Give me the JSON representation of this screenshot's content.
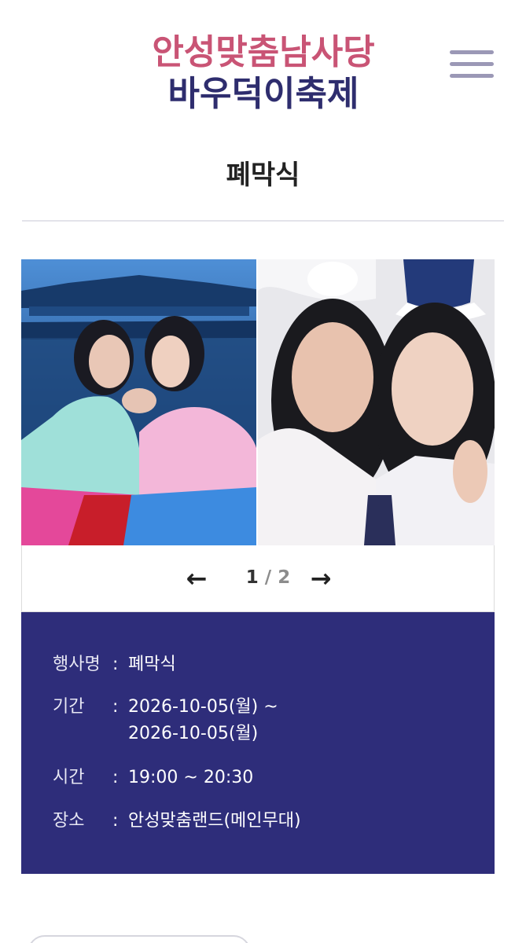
{
  "header": {
    "logo_line1": "안성맞춤남사당",
    "logo_line2": "바우덕이축제",
    "menu_icon": "hamburger-menu-icon"
  },
  "page": {
    "title": "폐막식"
  },
  "gallery": {
    "images": [
      {
        "description_icon": "performers-photo"
      },
      {
        "description_icon": "performers-photo"
      }
    ],
    "current": "1",
    "separator": "/",
    "total": "2",
    "prev_icon": "arrow-left-icon",
    "next_icon": "arrow-right-icon",
    "prev_glyph": "←",
    "next_glyph": "→"
  },
  "event_info": {
    "colon": ":",
    "name_label": "행사명",
    "name_value": "폐막식",
    "period_label": "기간",
    "period_value_line1": "2026-10-05(월) ~",
    "period_value_line2": "2026-10-05(월)",
    "time_label": "시간",
    "time_value": "19:00 ~ 20:30",
    "place_label": "장소",
    "place_value": "안성맞춤랜드(메인무대)"
  },
  "colors": {
    "logo_pink": "#c95475",
    "logo_navy": "#2e2d6e",
    "info_background": "#2e2d7a",
    "menu_icon": "#9b98b6"
  }
}
